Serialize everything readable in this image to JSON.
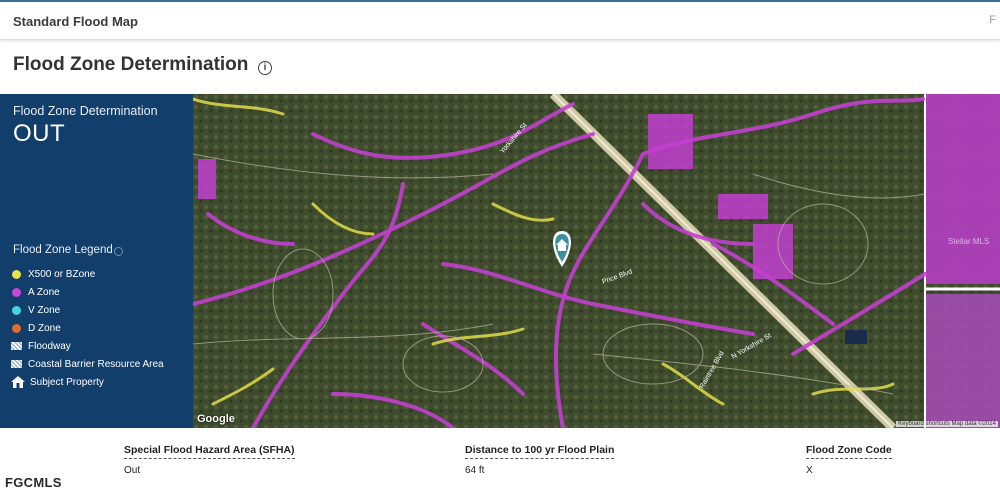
{
  "header": {
    "title": "Standard Flood Map",
    "edge_text": "F"
  },
  "page": {
    "heading": "Flood Zone Determination",
    "info_icon": "info-icon"
  },
  "panel": {
    "determination_label": "Flood Zone Determination",
    "determination_value": "OUT",
    "legend_title": "Flood Zone Legend",
    "legend": [
      {
        "label": "X500 or BZone",
        "color": "#e7e34a",
        "icon": "dot"
      },
      {
        "label": "A Zone",
        "color": "#c447d6",
        "icon": "dot"
      },
      {
        "label": "V Zone",
        "color": "#43d3e0",
        "icon": "dot"
      },
      {
        "label": "D Zone",
        "color": "#e06d2e",
        "icon": "dot"
      },
      {
        "label": "Floodway",
        "icon": "hatch"
      },
      {
        "label": "Coastal Barrier Resource Area",
        "icon": "hatch"
      },
      {
        "label": "Subject Property",
        "icon": "home-icon"
      }
    ]
  },
  "map": {
    "google": "Google",
    "attribution": "Keyboard shortcuts   Map data ©2024",
    "marker_icon": "home-marker-icon",
    "roads": [
      "Yorkshire St",
      "Price Blvd",
      "Raintree Blvd",
      "N Yorkshire St"
    ],
    "corner_watermark": "Stellar MLS"
  },
  "info": [
    {
      "label": "Special Flood Hazard Area (SFHA)",
      "value": "Out"
    },
    {
      "label": "Distance to 100 yr Flood Plain",
      "value": "64 ft"
    },
    {
      "label": "Flood Zone Code",
      "value": "X"
    }
  ],
  "watermark": "FGCMLS"
}
